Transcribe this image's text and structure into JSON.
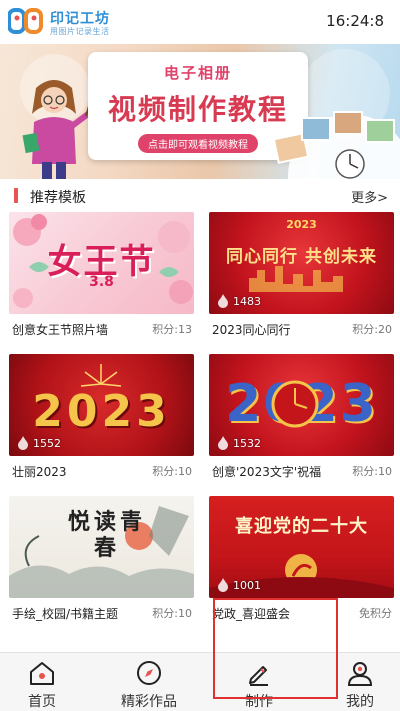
{
  "app": {
    "logo_title": "印记工坊",
    "logo_subtitle": "用图片记录生活",
    "clock": "16:24:8"
  },
  "banner": {
    "title": "电子相册",
    "main": "视频制作教程",
    "cta": "点击即可观看视频教程"
  },
  "section": {
    "title": "推荐模板",
    "more": "更多>"
  },
  "cards": [
    {
      "name": "创意女王节照片墙",
      "points": "积分:13",
      "views": "",
      "art_text": "女王节",
      "art_sub": "3.8"
    },
    {
      "name": "2023同心同行",
      "points": "积分:20",
      "views": "1483",
      "art_text": "同心同行 共创未来",
      "art_sub": "2023"
    },
    {
      "name": "壮丽2023",
      "points": "积分:10",
      "views": "1552",
      "art_text": "2023",
      "art_sub": ""
    },
    {
      "name": "创意'2023文字'祝福",
      "points": "积分:10",
      "views": "1532",
      "art_text": "2023",
      "art_sub": ""
    },
    {
      "name": "手绘_校园/书籍主题",
      "points": "积分:10",
      "views": "",
      "art_text": "悦读青春",
      "art_sub": ""
    },
    {
      "name": "党政_喜迎盛会",
      "points": "免积分",
      "views": "1001",
      "art_text": "喜迎党的二十大",
      "art_sub": ""
    }
  ],
  "nav": [
    {
      "label": "首页",
      "icon": "home-icon"
    },
    {
      "label": "精彩作品",
      "icon": "compass-icon"
    },
    {
      "label": "制作",
      "icon": "pencil-icon"
    },
    {
      "label": "我的",
      "icon": "user-icon"
    }
  ],
  "colors": {
    "accent": "#e8524f",
    "brand_blue": "#2f8fd6",
    "banner_pink": "#e0436a",
    "highlight": "#e03030"
  }
}
